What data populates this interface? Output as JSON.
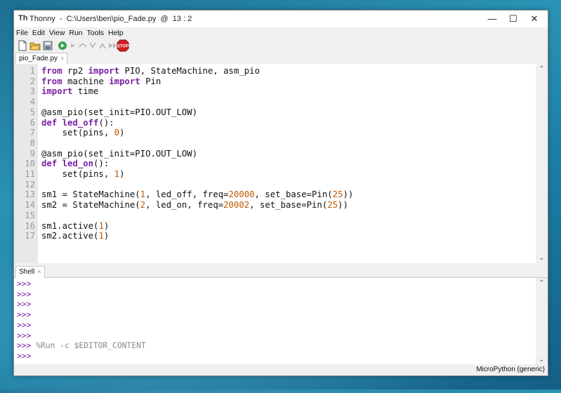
{
  "window": {
    "app_icon": "Th",
    "title": "Thonny  -  C:\\Users\\ben\\pio_Fade.py  @  13 : 2",
    "controls": [
      "—",
      "☐",
      "✕"
    ]
  },
  "menu": [
    "File",
    "Edit",
    "View",
    "Run",
    "Tools",
    "Help"
  ],
  "toolbar": {
    "icons": [
      "new-file-icon",
      "open-folder-icon",
      "save-icon",
      "run-icon",
      "debug-icon",
      "step-over-icon",
      "step-into-icon",
      "step-out-icon",
      "resume-icon",
      "stop-icon"
    ],
    "stop_label": "STOP"
  },
  "editor": {
    "tab_label": "pio_Fade.py",
    "tab_close": "×",
    "lines": [
      {
        "n": "1",
        "code": "from rp2 import PIO, StateMachine, asm_pio"
      },
      {
        "n": "2",
        "code": "from machine import Pin"
      },
      {
        "n": "3",
        "code": "import time"
      },
      {
        "n": "4",
        "code": ""
      },
      {
        "n": "5",
        "code": "@asm_pio(set_init=PIO.OUT_LOW)"
      },
      {
        "n": "6",
        "code": "def led_off():"
      },
      {
        "n": "7",
        "code": "    set(pins, 0)"
      },
      {
        "n": "8",
        "code": ""
      },
      {
        "n": "9",
        "code": "@asm_pio(set_init=PIO.OUT_LOW)"
      },
      {
        "n": "10",
        "code": "def led_on():"
      },
      {
        "n": "11",
        "code": "    set(pins, 1)"
      },
      {
        "n": "12",
        "code": ""
      },
      {
        "n": "13",
        "code": "sm1 = StateMachine(1, led_off, freq=20000, set_base=Pin(25))"
      },
      {
        "n": "14",
        "code": "sm2 = StateMachine(2, led_on, freq=20002, set_base=Pin(25))"
      },
      {
        "n": "15",
        "code": ""
      },
      {
        "n": "16",
        "code": "sm1.active(1)"
      },
      {
        "n": "17",
        "code": "sm2.active(1)"
      }
    ]
  },
  "shell": {
    "tab_label": "Shell",
    "tab_close": "×",
    "prompt": ">>>",
    "lines": [
      ">>>",
      ">>>",
      ">>>",
      ">>>",
      ">>>",
      ">>>",
      ">>>",
      ">>>"
    ],
    "command": "%Run -c $EDITOR_CONTENT"
  },
  "status": {
    "interpreter": "MicroPython (generic)"
  }
}
